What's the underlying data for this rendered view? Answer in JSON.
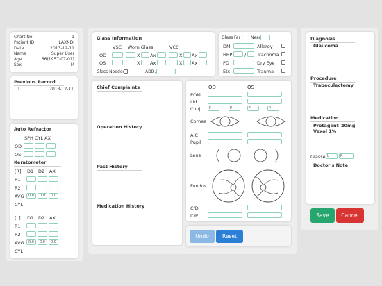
{
  "patient": {
    "rows": [
      {
        "label": "Chart No.",
        "value": "1"
      },
      {
        "label": "Patient ID",
        "value": "LAXNDI"
      },
      {
        "label": "Date",
        "value": "2013-12-11"
      },
      {
        "label": "Name",
        "value": "Super User"
      },
      {
        "label": "Age",
        "value": "56(1957-07-01)"
      },
      {
        "label": "Sex",
        "value": "M"
      }
    ]
  },
  "previous_record": {
    "title": "Previous Record",
    "number": "1",
    "date": "2013-12-11"
  },
  "auto_refractor": {
    "title": "Auto Refractor",
    "col_headers": "SPH CYL AX",
    "od_label": "OD",
    "os_label": "OS",
    "keratometer_title": "Keratometer",
    "right": {
      "header": [
        "[R]",
        "D1",
        "D2",
        "AX"
      ],
      "r1": "R1",
      "r2": "R2",
      "avg": "AVG",
      "avg_values": [
        "0.0",
        "0.0",
        "0.0"
      ],
      "cyl": "CYL"
    },
    "left": {
      "header": [
        "[L]",
        "D1",
        "D2",
        "AX"
      ],
      "r1": "R1",
      "r2": "R2",
      "avg": "AVG",
      "avg_values": [
        "0.0",
        "0.0",
        "0.0"
      ],
      "cyl": "CYL"
    }
  },
  "glass_info": {
    "title": "Glass Information",
    "vsc": "VSC",
    "worn_glass": "Worn Glass",
    "vcc": "VCC",
    "od": "OD",
    "os": "OS",
    "x": "X",
    "ax": "Ax",
    "glass_needed": "Glass Needed",
    "add": "ADD."
  },
  "glass_far_near": {
    "glass": "Glass",
    "far": "Far",
    "near": "Near",
    "dm": "DM",
    "hbp": "HBP",
    "hbp_sep": "/",
    "pd": "PD",
    "etc": "Etc.",
    "allergy": "Allergy",
    "trachoma": "Trachoma",
    "dry_eye": "Dry Eye",
    "trauma": "Trauma"
  },
  "history": {
    "chief_complaints": "Chief Complaints",
    "operation_history": "Operation History",
    "past_history": "Past History",
    "medication_history": "Medication History"
  },
  "exam": {
    "od": "OD",
    "os": "OS",
    "eom": "EOM",
    "lid": "Lid",
    "conj": "Conj",
    "f": "F",
    "p": "P",
    "cornea": "Cornea",
    "ac": "A.C",
    "pupil": "Pupil",
    "lens": "Lens",
    "fundus": "Fundus",
    "cd": "C/D",
    "iop": "IOP"
  },
  "buttons": {
    "undo": "Undo",
    "reset": "Reset",
    "save": "Save",
    "cancel": "Cancel"
  },
  "diagnosis": {
    "title": "Diagnosis",
    "value": "Glaucoma",
    "procedure_title": "Procedure",
    "procedure_value": "Trabeculectomy",
    "medication_title": "Medication",
    "medication_line1": "Protagent_20mg_",
    "medication_line2": "Vexol 1%",
    "glasses_label": "Glasses",
    "glasses_l": "L",
    "glasses_r": "R",
    "doctors_note": "Doctor's Note"
  },
  "colors": {
    "undo": "#8cb8e6",
    "reset": "#2b7fd4",
    "save": "#27a66f",
    "cancel": "#d93434",
    "field_border": "#8fd0bf"
  }
}
